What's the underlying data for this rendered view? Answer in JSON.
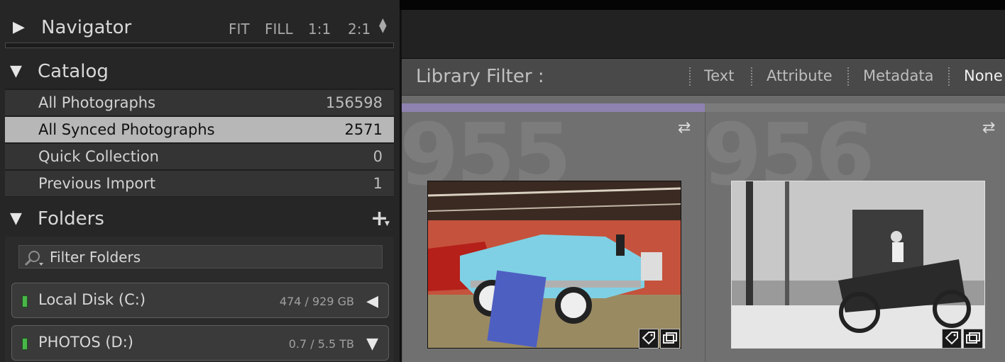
{
  "navigator": {
    "title": "Navigator",
    "options": [
      "FIT",
      "FILL",
      "1:1",
      "2:1"
    ]
  },
  "catalog": {
    "title": "Catalog",
    "items": [
      {
        "label": "All Photographs",
        "count": "156598"
      },
      {
        "label": "All Synced Photographs",
        "count": "2571"
      },
      {
        "label": "Quick Collection",
        "count": "0"
      },
      {
        "label": "Previous Import",
        "count": "1"
      }
    ]
  },
  "folders": {
    "title": "Folders",
    "filter_placeholder": "Filter Folders",
    "disks": [
      {
        "name": "Local Disk (C:)",
        "size": "474 / 929 GB"
      },
      {
        "name": "PHOTOS (D:)",
        "size": "0.7 / 5.5 TB"
      }
    ]
  },
  "library_filter": {
    "title": "Library Filter :",
    "options": [
      "Text",
      "Attribute",
      "Metadata",
      "None"
    ]
  },
  "grid": {
    "cells": [
      {
        "index": "955"
      },
      {
        "index": "956"
      }
    ]
  },
  "colors": {
    "selected_row": "#b7b7b7",
    "accent_strip": "#8e82b0",
    "disk_led": "#49b649"
  }
}
